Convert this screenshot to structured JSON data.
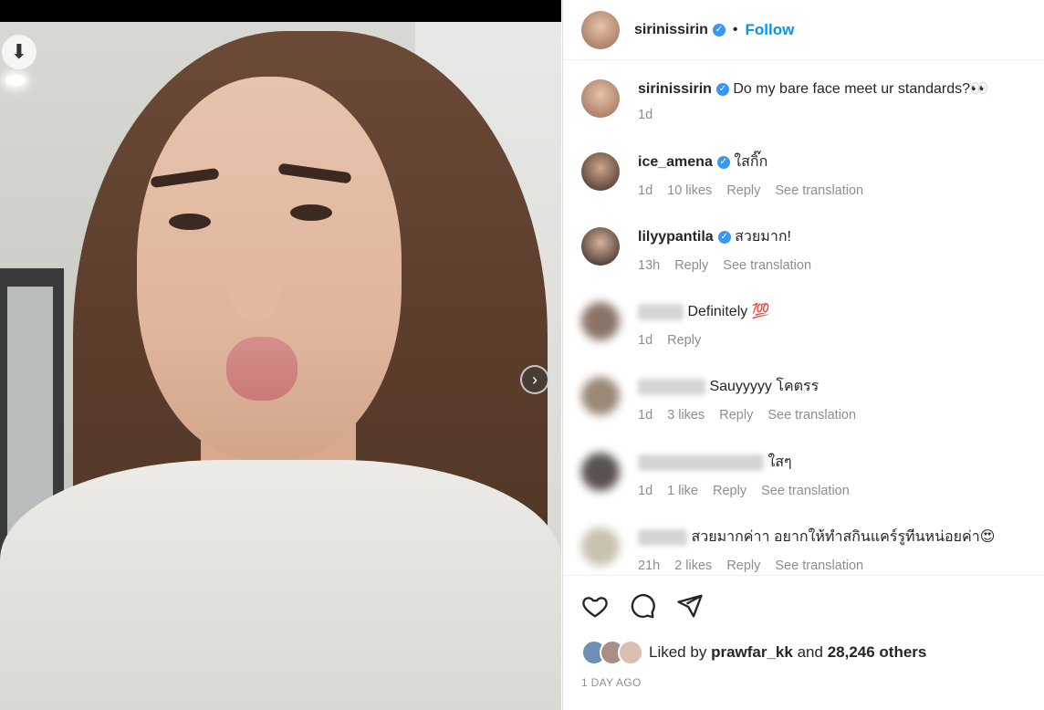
{
  "post": {
    "username": "sirinissirin",
    "follow_label": "Follow",
    "dot": "•",
    "caption": "Do my bare face meet ur standards?👀",
    "caption_time": "1d"
  },
  "comments": [
    {
      "username": "ice_amena",
      "verified": true,
      "text": "ใสกิ๊ก",
      "time": "1d",
      "likes": "10 likes",
      "reply": "Reply",
      "translate": "See translation"
    },
    {
      "username": "lilyypantila",
      "verified": true,
      "text": "สวยมาก!",
      "time": "13h",
      "likes": "",
      "reply": "Reply",
      "translate": "See translation"
    },
    {
      "username": "",
      "text": "Definitely 💯",
      "time": "1d",
      "likes": "",
      "reply": "Reply",
      "translate": ""
    },
    {
      "username": "",
      "text": "Sauyyyyy โคตรร",
      "time": "1d",
      "likes": "3 likes",
      "reply": "Reply",
      "translate": "See translation"
    },
    {
      "username": "",
      "text": "ใสๆ",
      "time": "1d",
      "likes": "1 like",
      "reply": "Reply",
      "translate": "See translation"
    },
    {
      "username": "",
      "text": "สวยมากค่าา อยากให้ทำสกินแคร์รูทีนหน่อยค่า😍",
      "time": "21h",
      "likes": "2 likes",
      "reply": "Reply",
      "translate": "See translation"
    }
  ],
  "footer": {
    "liked_by_prefix": "Liked by",
    "liked_by_user": "prawfar_kk",
    "and": "and",
    "others": "28,246 others",
    "time_ago": "1 DAY AGO"
  },
  "icons": [
    "download-icon",
    "chevron-right-icon",
    "heart-icon",
    "comment-icon",
    "share-icon",
    "verified-icon"
  ],
  "colors": {
    "accent": "#0095f6",
    "verified": "#3897f0",
    "muted": "#8e8e8e"
  }
}
